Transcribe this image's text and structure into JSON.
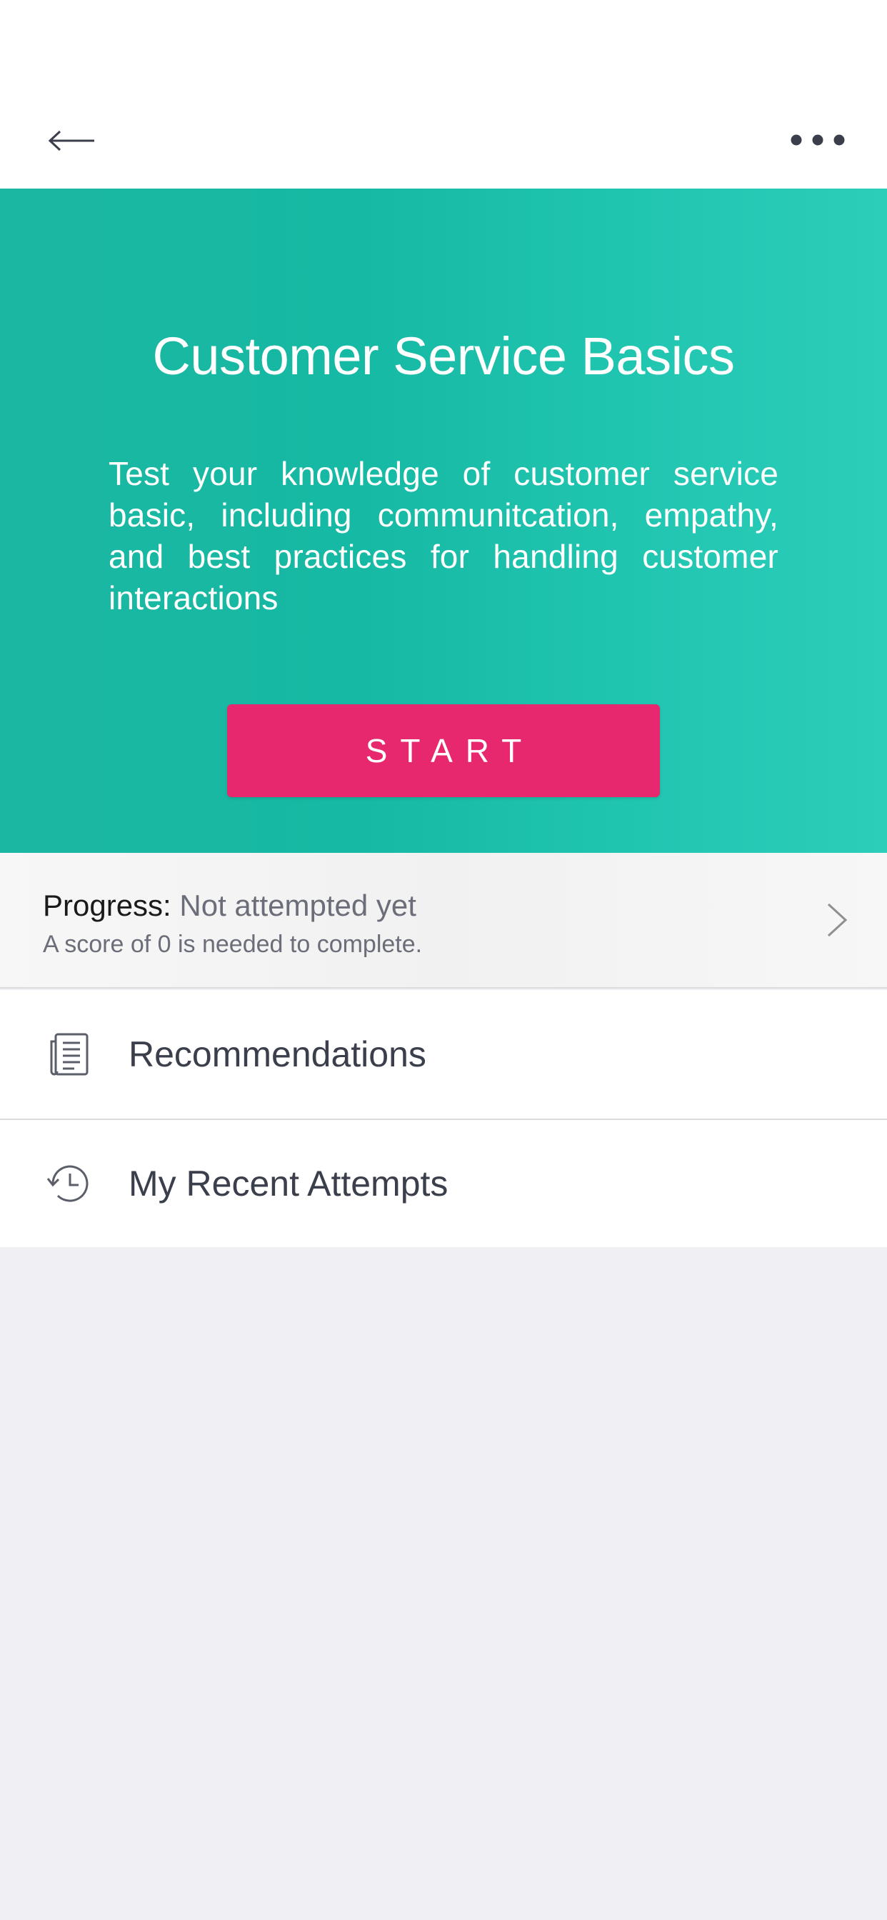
{
  "header": {
    "back_icon": "arrow-left-icon",
    "more_icon": "more-horizontal-icon"
  },
  "hero": {
    "title": "Customer Service Basics",
    "description": "Test your knowledge of customer service basic, including communitcation, empathy, and best practices for handling customer interactions",
    "start_label": "START",
    "colors": {
      "gradient_start": "#1bb7a2",
      "gradient_end": "#2ccdb9",
      "start_button": "#e8286e"
    }
  },
  "progress": {
    "label": "Progress:",
    "status": "Not attempted yet",
    "requirement": "A score of 0 is needed to complete.",
    "chevron_icon": "chevron-right-icon"
  },
  "menu": {
    "items": [
      {
        "label": "Recommendations",
        "icon": "document-list-icon"
      },
      {
        "label": "My Recent Attempts",
        "icon": "history-icon"
      }
    ]
  }
}
